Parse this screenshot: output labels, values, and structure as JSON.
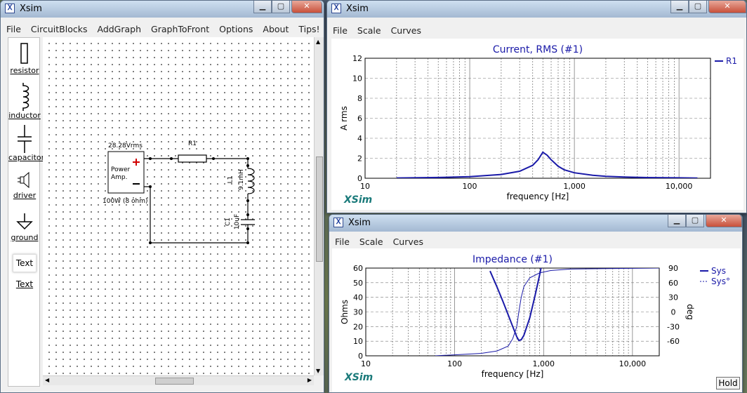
{
  "left_window": {
    "title": "Xsim",
    "menu": [
      "File",
      "CircuitBlocks",
      "AddGraph",
      "GraphToFront",
      "Options",
      "About",
      "Tips!"
    ],
    "palette": [
      {
        "label": "resistor",
        "icon": "resistor-icon"
      },
      {
        "label": "inductor",
        "icon": "inductor-icon"
      },
      {
        "label": "capacitor",
        "icon": "capacitor-icon"
      },
      {
        "label": "driver",
        "icon": "speaker-icon"
      },
      {
        "label": "ground",
        "icon": "ground-icon"
      },
      {
        "label": "Text",
        "icon": "text-box-icon"
      },
      {
        "label": "Text",
        "icon": ""
      }
    ],
    "circuit": {
      "source_voltage": "28.28Vrms",
      "source_label": "Power Amp.",
      "source_rating": "100W (8 ohm)",
      "plus": "+",
      "minus": "−",
      "r1": "R1",
      "l1_name": "L1",
      "l1_value": "9.1mH",
      "c1_name": "C1",
      "c1_value": "10uF"
    }
  },
  "current_window": {
    "title": "Xsim",
    "menu": [
      "File",
      "Scale",
      "Curves"
    ],
    "logo": "XSim"
  },
  "impedance_window": {
    "title": "Xsim",
    "menu": [
      "File",
      "Scale",
      "Curves"
    ],
    "logo": "XSim",
    "hold_button": "Hold"
  },
  "chart_data": [
    {
      "type": "line",
      "title": "Current, RMS (#1)",
      "xlabel": "frequency [Hz]",
      "ylabel": "A rms",
      "x_scale": "log",
      "xlim": [
        10,
        20000
      ],
      "ylim": [
        0,
        12
      ],
      "x_ticks": [
        "10",
        "100",
        "1,000",
        "10,000"
      ],
      "y_ticks": [
        "0",
        "2",
        "4",
        "6",
        "8",
        "10",
        "12"
      ],
      "grid": true,
      "legend_position": "right",
      "series": [
        {
          "name": "R1",
          "color": "#1a1aa8",
          "x": [
            20,
            50,
            100,
            200,
            300,
            400,
            450,
            500,
            550,
            600,
            700,
            800,
            1000,
            1500,
            2000,
            3000,
            5000,
            10000,
            15000
          ],
          "y": [
            0.03,
            0.08,
            0.16,
            0.38,
            0.7,
            1.3,
            1.85,
            2.6,
            2.3,
            1.85,
            1.2,
            0.85,
            0.55,
            0.3,
            0.2,
            0.12,
            0.07,
            0.04,
            0.02
          ]
        }
      ]
    },
    {
      "type": "line",
      "title": "Impedance (#1)",
      "xlabel": "frequency [Hz]",
      "ylabel": "Ohms",
      "y2label": "deg",
      "x_scale": "log",
      "xlim": [
        10,
        20000
      ],
      "ylim": [
        0,
        60
      ],
      "y2lim": [
        -90,
        90
      ],
      "x_ticks": [
        "10",
        "100",
        "1,000",
        "10,000"
      ],
      "y_ticks": [
        "0",
        "10",
        "20",
        "30",
        "40",
        "50",
        "60"
      ],
      "y2_ticks": [
        "-60",
        "-30",
        "0",
        "30",
        "60",
        "90"
      ],
      "grid": true,
      "legend_position": "right",
      "series": [
        {
          "name": "Sys",
          "axis": "left",
          "style": "solid",
          "color": "#1a1aa8",
          "x": [
            250,
            300,
            350,
            400,
            450,
            500,
            527,
            560,
            600,
            700,
            800,
            900,
            950
          ],
          "y": [
            58,
            47,
            37,
            28,
            20,
            13,
            10.5,
            11,
            14,
            26,
            41,
            55,
            62
          ]
        },
        {
          "name": "Sys°",
          "axis": "right",
          "style": "dashed",
          "color": "#1a1aa8",
          "x": [
            60,
            100,
            200,
            300,
            400,
            450,
            500,
            527,
            560,
            600,
            700,
            900,
            1200,
            2000,
            5000,
            20000
          ],
          "y": [
            -90,
            -88,
            -85,
            -80,
            -70,
            -55,
            -30,
            0,
            30,
            52,
            70,
            80,
            85,
            88,
            89,
            90
          ]
        }
      ]
    }
  ]
}
